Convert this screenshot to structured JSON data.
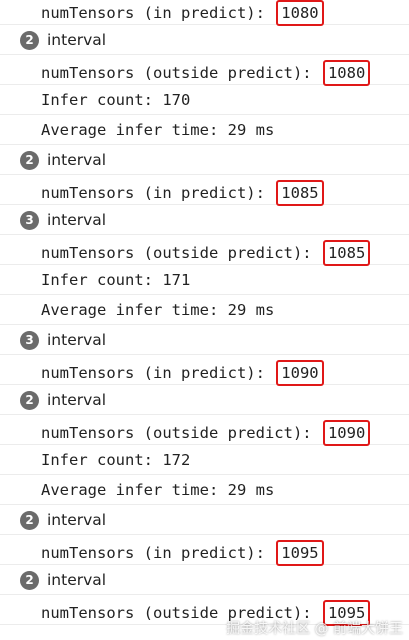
{
  "rows": [
    {
      "type": "log",
      "text": "numTensors (in predict): ",
      "value": "1080"
    },
    {
      "type": "group",
      "count": "2",
      "label": "interval"
    },
    {
      "type": "log",
      "text": "numTensors (outside predict): ",
      "value": "1080"
    },
    {
      "type": "log",
      "text": "Infer count: 170"
    },
    {
      "type": "log",
      "text": "Average infer time: 29 ms"
    },
    {
      "type": "group",
      "count": "2",
      "label": "interval"
    },
    {
      "type": "log",
      "text": "numTensors (in predict): ",
      "value": "1085"
    },
    {
      "type": "group",
      "count": "3",
      "label": "interval"
    },
    {
      "type": "log",
      "text": "numTensors (outside predict): ",
      "value": "1085"
    },
    {
      "type": "log",
      "text": "Infer count: 171"
    },
    {
      "type": "log",
      "text": "Average infer time: 29 ms"
    },
    {
      "type": "group",
      "count": "3",
      "label": "interval"
    },
    {
      "type": "log",
      "text": "numTensors (in predict): ",
      "value": "1090"
    },
    {
      "type": "group",
      "count": "2",
      "label": "interval"
    },
    {
      "type": "log",
      "text": "numTensors (outside predict): ",
      "value": "1090"
    },
    {
      "type": "log",
      "text": "Infer count: 172"
    },
    {
      "type": "log",
      "text": "Average infer time: 29 ms"
    },
    {
      "type": "group",
      "count": "2",
      "label": "interval"
    },
    {
      "type": "log",
      "text": "numTensors (in predict): ",
      "value": "1095"
    },
    {
      "type": "group",
      "count": "2",
      "label": "interval"
    },
    {
      "type": "log",
      "text": "numTensors (outside predict): ",
      "value": "1095"
    }
  ],
  "watermark": "掘金技术社区 @ 前端大饼王",
  "colors": {
    "highlight": "#e01818",
    "badge": "#6b6b6b"
  }
}
